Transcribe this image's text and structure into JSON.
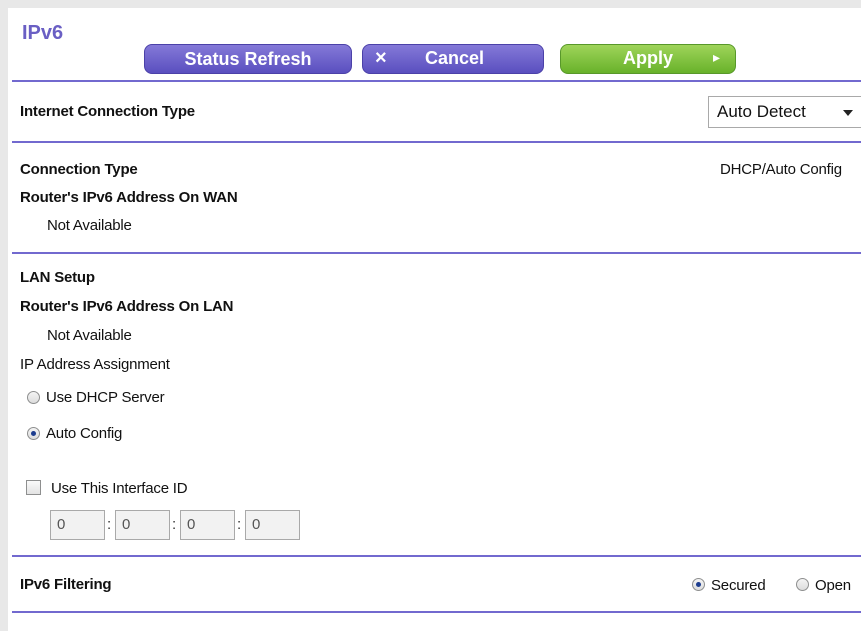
{
  "page": {
    "title": "IPv6"
  },
  "toolbar": {
    "status_refresh": "Status Refresh",
    "cancel": "Cancel",
    "cancel_icon": "×",
    "apply": "Apply",
    "apply_icon": "▸"
  },
  "internet_connection": {
    "label": "Internet Connection Type",
    "selected": "Auto Detect"
  },
  "wan": {
    "connection_type_label": "Connection Type",
    "connection_type_value": "DHCP/Auto Config",
    "ipv6_wan_label": "Router's IPv6 Address On WAN",
    "ipv6_wan_value": "Not Available"
  },
  "lan": {
    "title": "LAN Setup",
    "ipv6_lan_label": "Router's IPv6 Address On LAN",
    "ipv6_lan_value": "Not Available",
    "assignment_label": "IP Address Assignment",
    "options": [
      {
        "label": "Use DHCP Server",
        "checked": false
      },
      {
        "label": "Auto Config",
        "checked": true
      }
    ],
    "interface_id_label": "Use This Interface ID",
    "interface_id_checked": false,
    "interface_id": [
      "0",
      "0",
      "0",
      "0"
    ]
  },
  "filtering": {
    "label": "IPv6 Filtering",
    "options": [
      {
        "label": "Secured",
        "checked": true
      },
      {
        "label": "Open",
        "checked": false
      }
    ]
  },
  "colors": {
    "accent": "#6a5fc4",
    "button_purple": "#6b60cc",
    "button_green": "#7cc23a",
    "divider": "#7269cf"
  }
}
